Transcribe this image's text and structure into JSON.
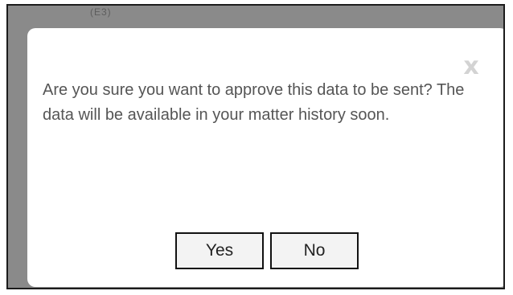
{
  "background": {
    "partial_text": "(E3)"
  },
  "dialog": {
    "close_glyph": "x",
    "message": "Are you sure you want to approve this data to be sent? The data will be available in your matter history soon.",
    "yes_label": "Yes",
    "no_label": "No"
  }
}
